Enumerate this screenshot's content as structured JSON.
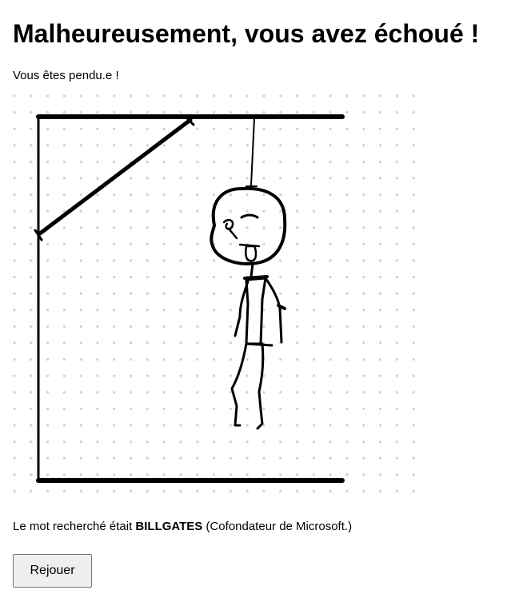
{
  "header": {
    "title": "Malheureusement, vous avez échoué !",
    "subtitle": "Vous êtes pendu.e !"
  },
  "drawing": {
    "background": "dot-grid",
    "stroke_color": "#000000",
    "dot_color": "#cfcfcf"
  },
  "result": {
    "prefix": "Le mot recherché était ",
    "word": "BILLGATES",
    "hint": " (Cofondateur de Microsoft.)"
  },
  "actions": {
    "replay_label": "Rejouer"
  }
}
